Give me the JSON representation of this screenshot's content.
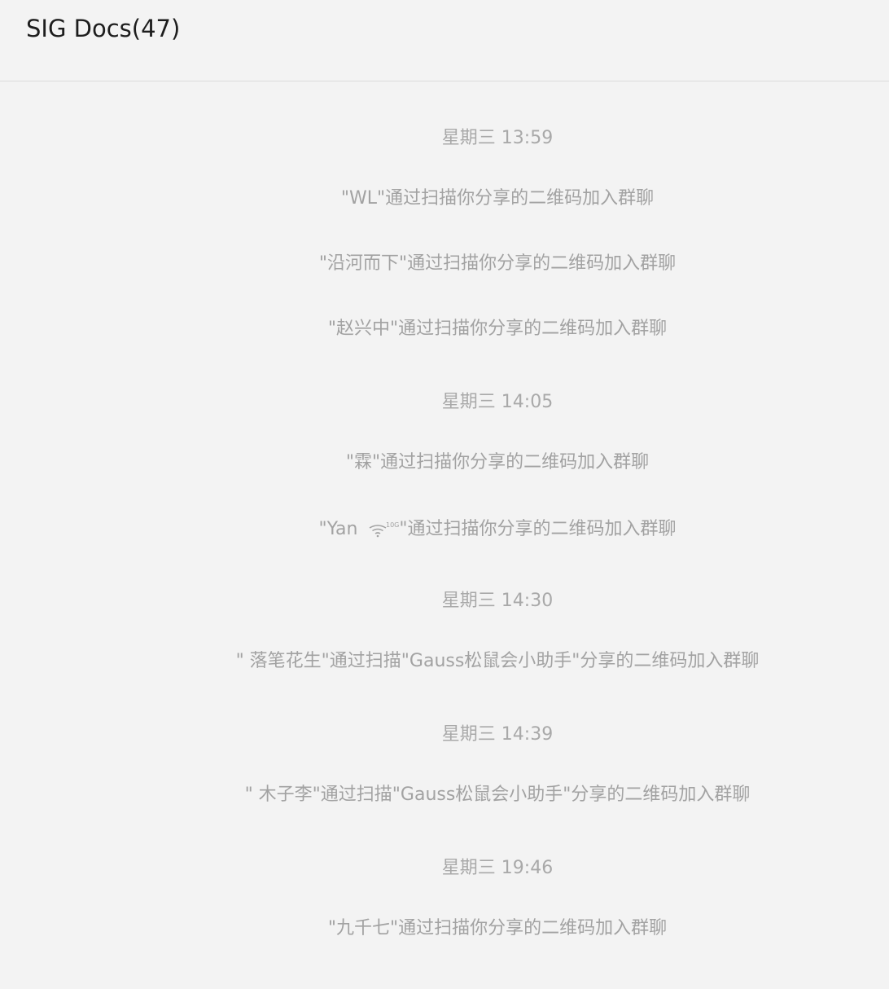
{
  "header": {
    "title": "SIG Docs(47)"
  },
  "feed": [
    {
      "kind": "time",
      "text": "星期三 13:59"
    },
    {
      "kind": "notice",
      "text": "\"WL\"通过扫描你分享的二维码加入群聊"
    },
    {
      "kind": "notice",
      "text": "\"沿河而下\"通过扫描你分享的二维码加入群聊"
    },
    {
      "kind": "notice",
      "text": "\"赵兴中\"通过扫描你分享的二维码加入群聊"
    },
    {
      "kind": "time",
      "text": "星期三 14:05"
    },
    {
      "kind": "notice",
      "text": "\"霖\"通过扫描你分享的二维码加入群聊"
    },
    {
      "kind": "notice-icon",
      "prefix": "\"Yan ",
      "icon": "wifi-10g-icon",
      "suffix": "\"通过扫描你分享的二维码加入群聊"
    },
    {
      "kind": "time",
      "text": "星期三 14:30"
    },
    {
      "kind": "notice",
      "text": "\" 落笔花生\"通过扫描\"Gauss松鼠会小助手\"分享的二维码加入群聊"
    },
    {
      "kind": "time",
      "text": "星期三 14:39"
    },
    {
      "kind": "notice",
      "text": "\" 木子李\"通过扫描\"Gauss松鼠会小助手\"分享的二维码加入群聊"
    },
    {
      "kind": "time",
      "text": "星期三 19:46"
    },
    {
      "kind": "notice",
      "text": "\"九千七\"通过扫描你分享的二维码加入群聊"
    }
  ]
}
